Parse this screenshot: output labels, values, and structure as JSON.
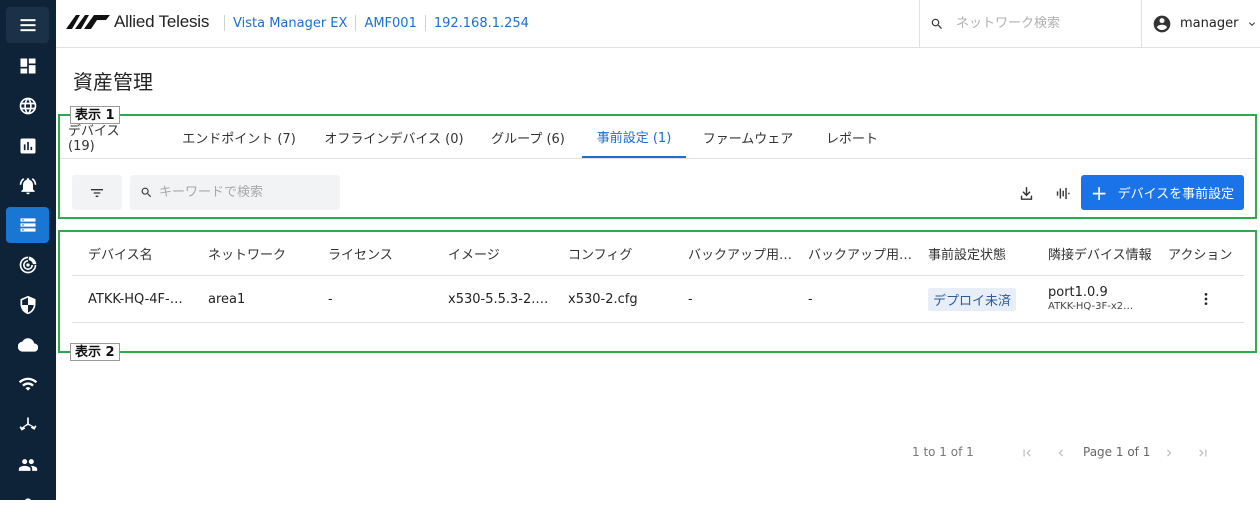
{
  "app": {
    "logo_text": "Allied Telesis",
    "breadcrumbs": [
      "Vista Manager EX",
      "AMF001",
      "192.168.1.254"
    ],
    "search_placeholder": "ネットワーク検索",
    "user": "manager"
  },
  "sidebar": {
    "items": [
      "menu-icon",
      "dashboard-icon",
      "globe-icon",
      "chart-icon",
      "alarm-icon",
      "asset-icon",
      "radar-icon",
      "shield-icon",
      "cloud-icon",
      "wifi-icon",
      "topology-icon",
      "users-icon"
    ],
    "active": "asset-icon"
  },
  "page": {
    "title": "資産管理",
    "annotation_1": "表示 1",
    "annotation_2": "表示 2"
  },
  "tabs": [
    {
      "label": "デバイス (19)"
    },
    {
      "label": "エンドポイント (7)"
    },
    {
      "label": "オフラインデバイス (0)"
    },
    {
      "label": "グループ (6)"
    },
    {
      "label": "事前設定 (1)",
      "active": true
    },
    {
      "label": "ファームウェア"
    },
    {
      "label": "レポート"
    }
  ],
  "toolbar": {
    "filter_icon": "filter-icon",
    "search_placeholder": "キーワードで検索",
    "download_icon": "download-icon",
    "columns_icon": "columns-icon",
    "add_button": "デバイスを事前設定"
  },
  "table": {
    "columns": [
      "デバイス名",
      "ネットワーク",
      "ライセンス",
      "イメージ",
      "コンフィグ",
      "バックアップ用…",
      "バックアップ用…",
      "事前設定状態",
      "隣接デバイス情報",
      "アクション"
    ],
    "rows": [
      {
        "device_name": "ATKK-HQ-4F-…",
        "network": "area1",
        "license": "-",
        "image": "x530-5.5.3-2.…",
        "config": "x530-2.cfg",
        "backup1": "-",
        "backup2": "-",
        "status": "デプロイ未済",
        "neighbor_port": "port1.0.9",
        "neighbor_device": "ATKK-HQ-3F-x2…"
      }
    ]
  },
  "pagination": {
    "count": "1 to 1 of 1",
    "page": "Page 1 of 1"
  },
  "colors": {
    "sidebar": "#0f2338",
    "accent": "#1a73e8",
    "annotation_frame": "#2eaa4b"
  }
}
